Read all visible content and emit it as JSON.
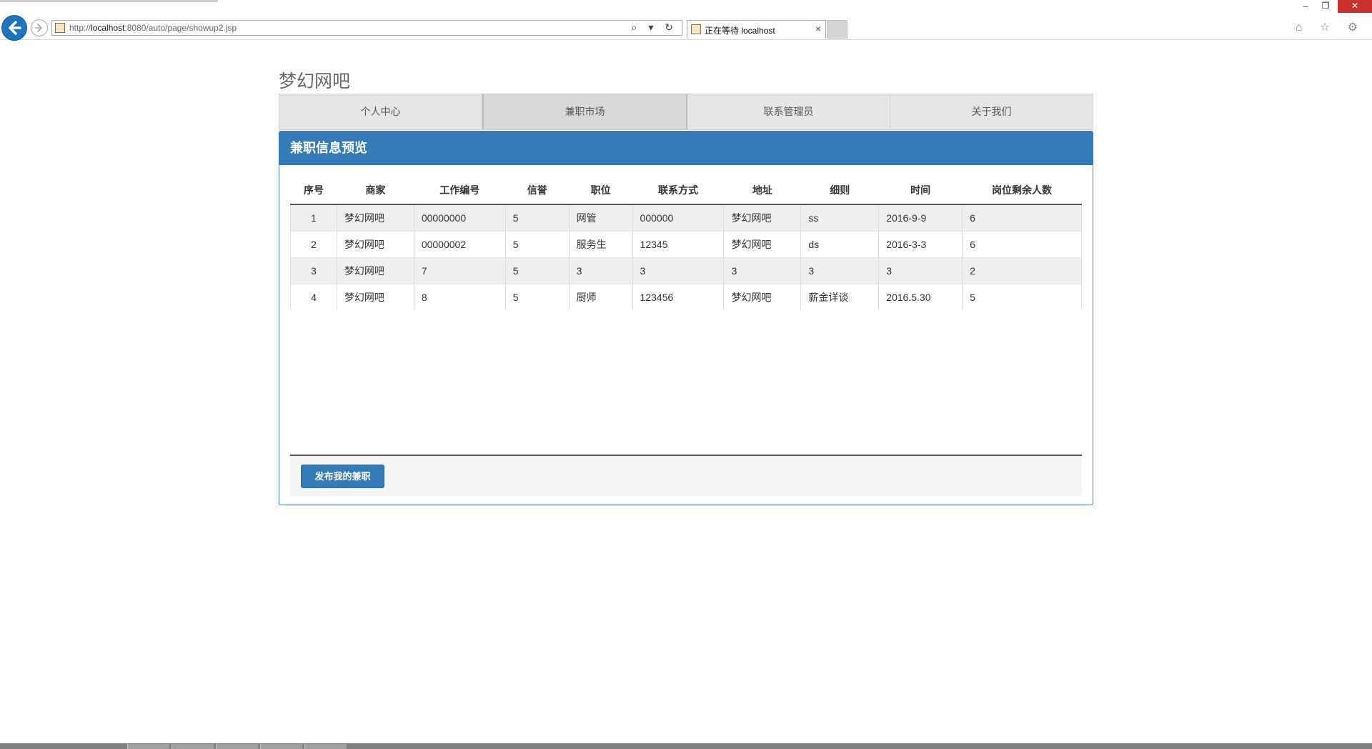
{
  "browser": {
    "url_prefix": "http://",
    "url_host": "localhost",
    "url_rest": ":8080/auto/page/showup2.jsp",
    "tab_title": "正在等待 localhost",
    "tab_close": "×",
    "addr_icons": "⌕ ▾ ↻",
    "win_min": "–",
    "win_max": "❐",
    "win_close": "✕",
    "toolbar_icons": "⌂ ☆ ⚙"
  },
  "site": {
    "title": "梦幻网吧"
  },
  "nav": {
    "items": [
      {
        "label": "个人中心"
      },
      {
        "label": "兼职市场"
      },
      {
        "label": "联系管理员"
      },
      {
        "label": "关于我们"
      }
    ]
  },
  "panel": {
    "heading": "兼职信息预览",
    "columns": [
      "序号",
      "商家",
      "工作编号",
      "信誉",
      "职位",
      "联系方式",
      "地址",
      "细则",
      "时间",
      "岗位剩余人数"
    ],
    "rows": [
      [
        "1",
        "梦幻网吧",
        "00000000",
        "5",
        "网管",
        "000000",
        "梦幻网吧",
        "ss",
        "2016-9-9",
        "6"
      ],
      [
        "2",
        "梦幻网吧",
        "00000002",
        "5",
        "服务生",
        "12345",
        "梦幻网吧",
        "ds",
        "2016-3-3",
        "6"
      ],
      [
        "3",
        "梦幻网吧",
        "7",
        "5",
        "3",
        "3",
        "3",
        "3",
        "3",
        "2"
      ],
      [
        "4",
        "梦幻网吧",
        "8",
        "5",
        "厨师",
        "123456",
        "梦幻网吧",
        "薪金详谈",
        "2016.5.30",
        "5"
      ]
    ],
    "publish_label": "发布我的兼职"
  }
}
